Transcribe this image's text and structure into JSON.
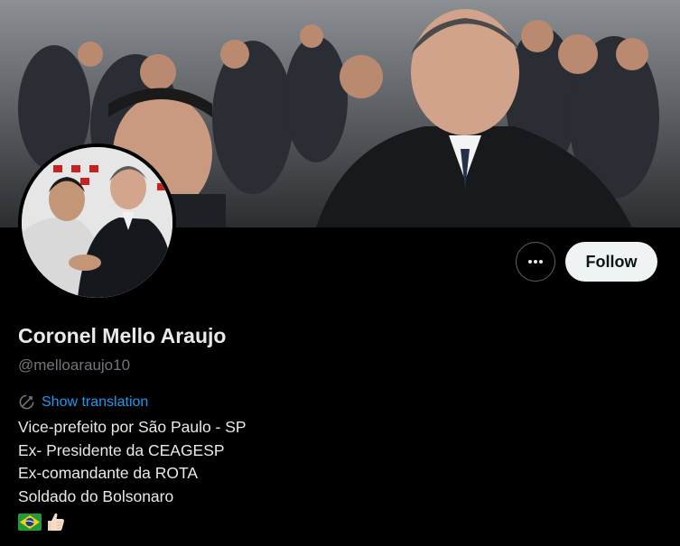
{
  "profile": {
    "display_name": "Coronel Mello Araujo",
    "handle": "@melloaraujo10",
    "follow_label": "Follow",
    "more_icon": "ellipsis-icon",
    "translation_label": "Show translation",
    "translation_icon": "translate-icon",
    "bio": [
      "Vice-prefeito por São Paulo - SP",
      "Ex- Presidente da CEAGESP",
      "Ex-comandante da ROTA",
      "Soldado do Bolsonaro"
    ],
    "bio_emoji": [
      "brazil-flag-icon",
      "thumbs-up-icon"
    ]
  },
  "colors": {
    "background": "#000000",
    "primary_text": "#e7e9ea",
    "secondary_text": "#71767b",
    "link": "#1d9bf0",
    "follow_bg": "#eff3f4"
  }
}
